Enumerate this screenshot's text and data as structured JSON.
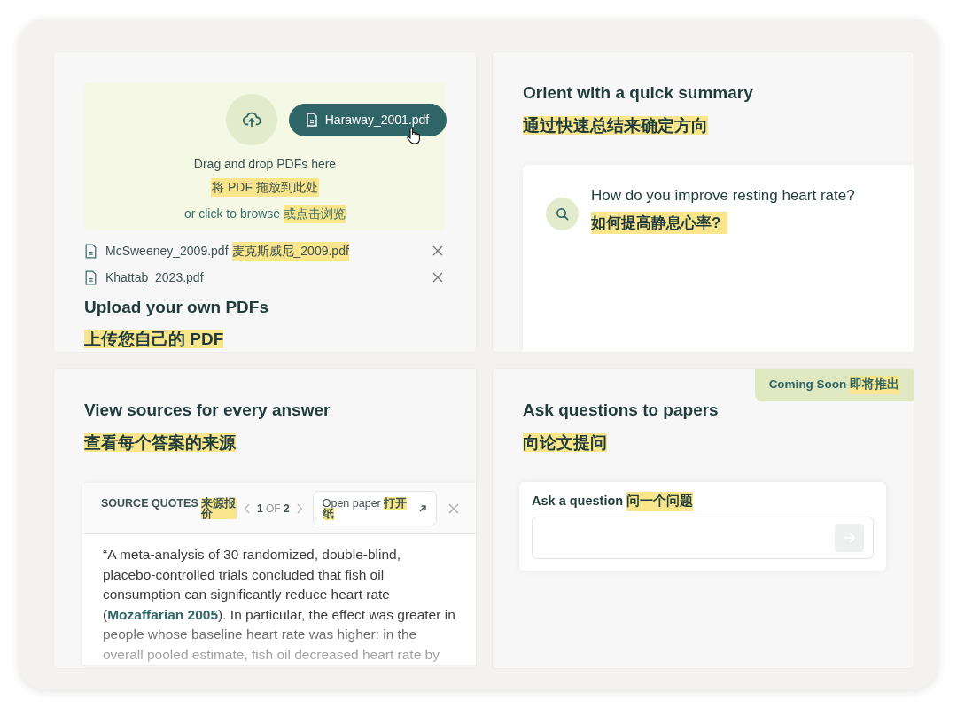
{
  "upload": {
    "file_chip": "Haraway_2001.pdf",
    "drop_text": "Drag and drop PDFs here",
    "drop_text_zh": "将 PDF 拖放到此处",
    "browse_text": "or click to browse",
    "browse_text_zh": "或点击浏览",
    "files": [
      {
        "name": "McSweeney_2009.pdf",
        "name_zh": "麦克斯威尼_2009.pdf"
      },
      {
        "name": "Khattab_2023.pdf"
      }
    ],
    "title": "Upload your own PDFs",
    "title_zh": "上传您自己的 PDF"
  },
  "summary": {
    "title": "Orient with a quick summary",
    "title_zh": "通过快速总结来确定方向",
    "question": "How do you improve resting heart rate?",
    "question_zh": "如何提高静息心率?"
  },
  "sources": {
    "title": "View sources for every answer",
    "title_zh": "查看每个答案的来源",
    "panel": {
      "label": "SOURCE QUOTES",
      "label_zh": "来源报价",
      "page_current": "1",
      "page_of": "OF",
      "page_total": "2",
      "open_button": "Open paper",
      "open_button_zh": "打开纸",
      "quote_before": "“A meta-analysis of 30 randomized, double-blind, placebo-controlled trials concluded that fish oil consumption can significantly reduce heart rate (",
      "citation": "Mozaffarian 2005",
      "quote_after": "). In particular, the effect was greater in people whose baseline heart rate was higher: in the overall pooled estimate, fish oil decreased heart rate by"
    }
  },
  "ask": {
    "badge": "Coming Soon",
    "badge_zh": "即将推出",
    "title": "Ask questions to papers",
    "title_zh": "向论文提问",
    "field_label": "Ask a question",
    "field_label_zh": "问一个问题"
  }
}
